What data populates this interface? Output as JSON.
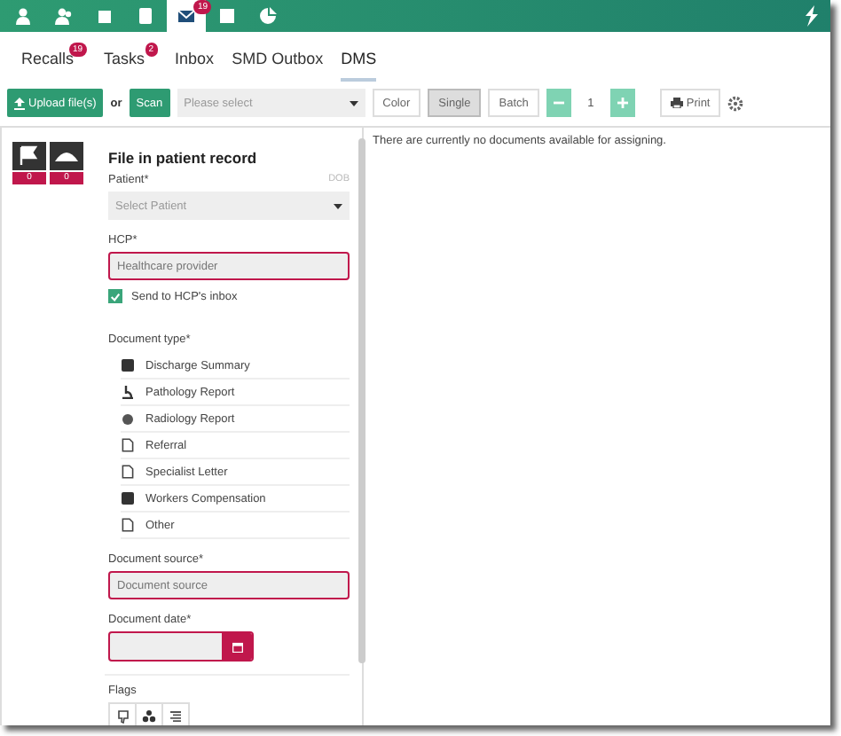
{
  "top_nav": [
    {
      "selected": false
    },
    {
      "selected": false
    },
    {
      "selected": false
    },
    {
      "selected": false
    },
    {
      "selected": true,
      "badge": "19"
    },
    {
      "selected": false
    },
    {
      "selected": false
    }
  ],
  "tabs": [
    {
      "label": "Recalls",
      "badge": "19",
      "selected": false
    },
    {
      "label": "Tasks",
      "badge": "2",
      "selected": false
    },
    {
      "label": "Inbox",
      "selected": false
    },
    {
      "label": "SMD Outbox",
      "selected": false
    },
    {
      "label": "DMS",
      "selected": true
    }
  ],
  "toolbar": {
    "upload": "Upload file(s)",
    "or": "or",
    "scan": "Scan",
    "select_placeholder": "Please select",
    "modes": [
      {
        "label": "Color",
        "selected": false
      },
      {
        "label": "Single",
        "selected": true
      },
      {
        "label": "Batch",
        "selected": false
      }
    ],
    "count": "1",
    "print": "Print"
  },
  "message": "There are currently no documents available for assigning.",
  "counters": [
    {
      "count": "0"
    },
    {
      "count": "0"
    }
  ],
  "form": {
    "title": "File in patient record",
    "patient": {
      "label": "Patient*",
      "dob": "DOB",
      "placeholder": "Select Patient"
    },
    "hcp": {
      "label": "HCP*",
      "placeholder": "Healthcare provider",
      "invalid": true
    },
    "send_to_inbox": {
      "label": "Send to HCP's inbox",
      "checked": true
    },
    "document_type": {
      "label": "Document type*",
      "items": [
        {
          "label": "Discharge Summary",
          "selected": false
        },
        {
          "label": "Pathology Report",
          "selected": false
        },
        {
          "label": "Radiology Report",
          "selected": false
        },
        {
          "label": "Referral",
          "selected": false
        },
        {
          "label": "Specialist Letter",
          "selected": false
        },
        {
          "label": "Workers Compensation",
          "selected": false
        },
        {
          "label": "Other",
          "selected": false
        }
      ]
    },
    "document_source": {
      "label": "Document source*",
      "placeholder": "Document source",
      "invalid": true
    },
    "document_date": {
      "label": "Document date*",
      "invalid": true
    },
    "flags": {
      "label": "Flags"
    }
  }
}
